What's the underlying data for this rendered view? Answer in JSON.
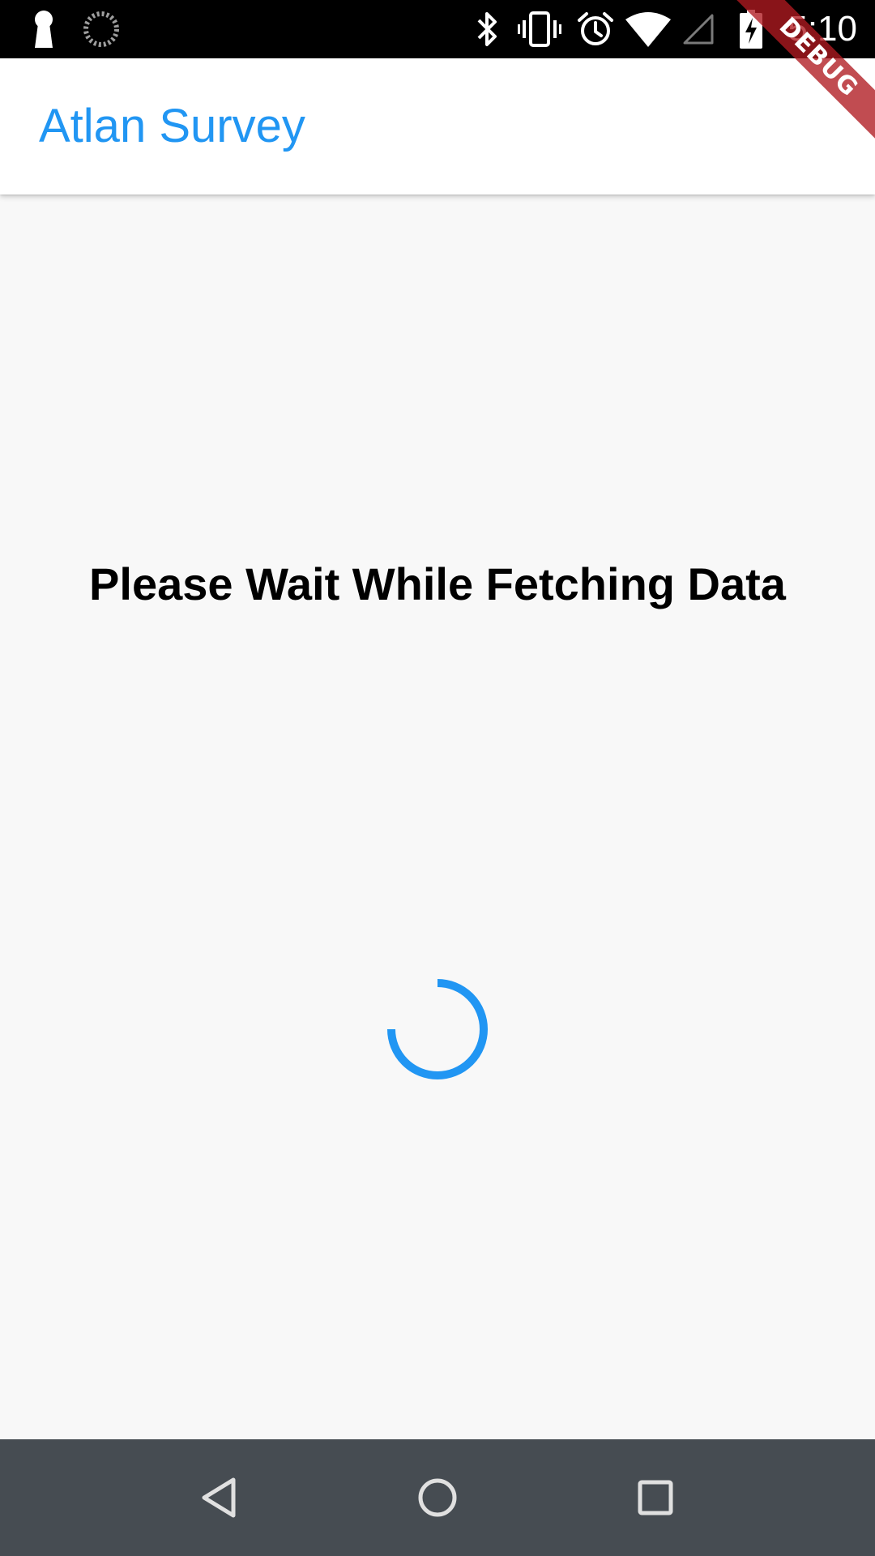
{
  "status_bar": {
    "time": "5:10",
    "left_icons": [
      "keyhole-icon",
      "sync-spinner-icon"
    ],
    "right_icons": [
      "bluetooth-icon",
      "vibrate-icon",
      "alarm-icon",
      "wifi-icon",
      "cell-signal-icon",
      "battery-charging-icon"
    ]
  },
  "app_bar": {
    "title": "Atlan Survey"
  },
  "debug_banner": {
    "label": "DEBUG"
  },
  "main": {
    "message": "Please Wait While Fetching Data"
  },
  "nav_bar": {
    "buttons": [
      "back-icon",
      "home-icon",
      "recents-icon"
    ]
  },
  "colors": {
    "accent": "#2196f3",
    "status_bar_bg": "#000000",
    "app_bar_bg": "#ffffff",
    "content_bg": "#f8f8f8",
    "nav_bar_bg": "#464c52",
    "debug_banner": "#b01a20"
  }
}
